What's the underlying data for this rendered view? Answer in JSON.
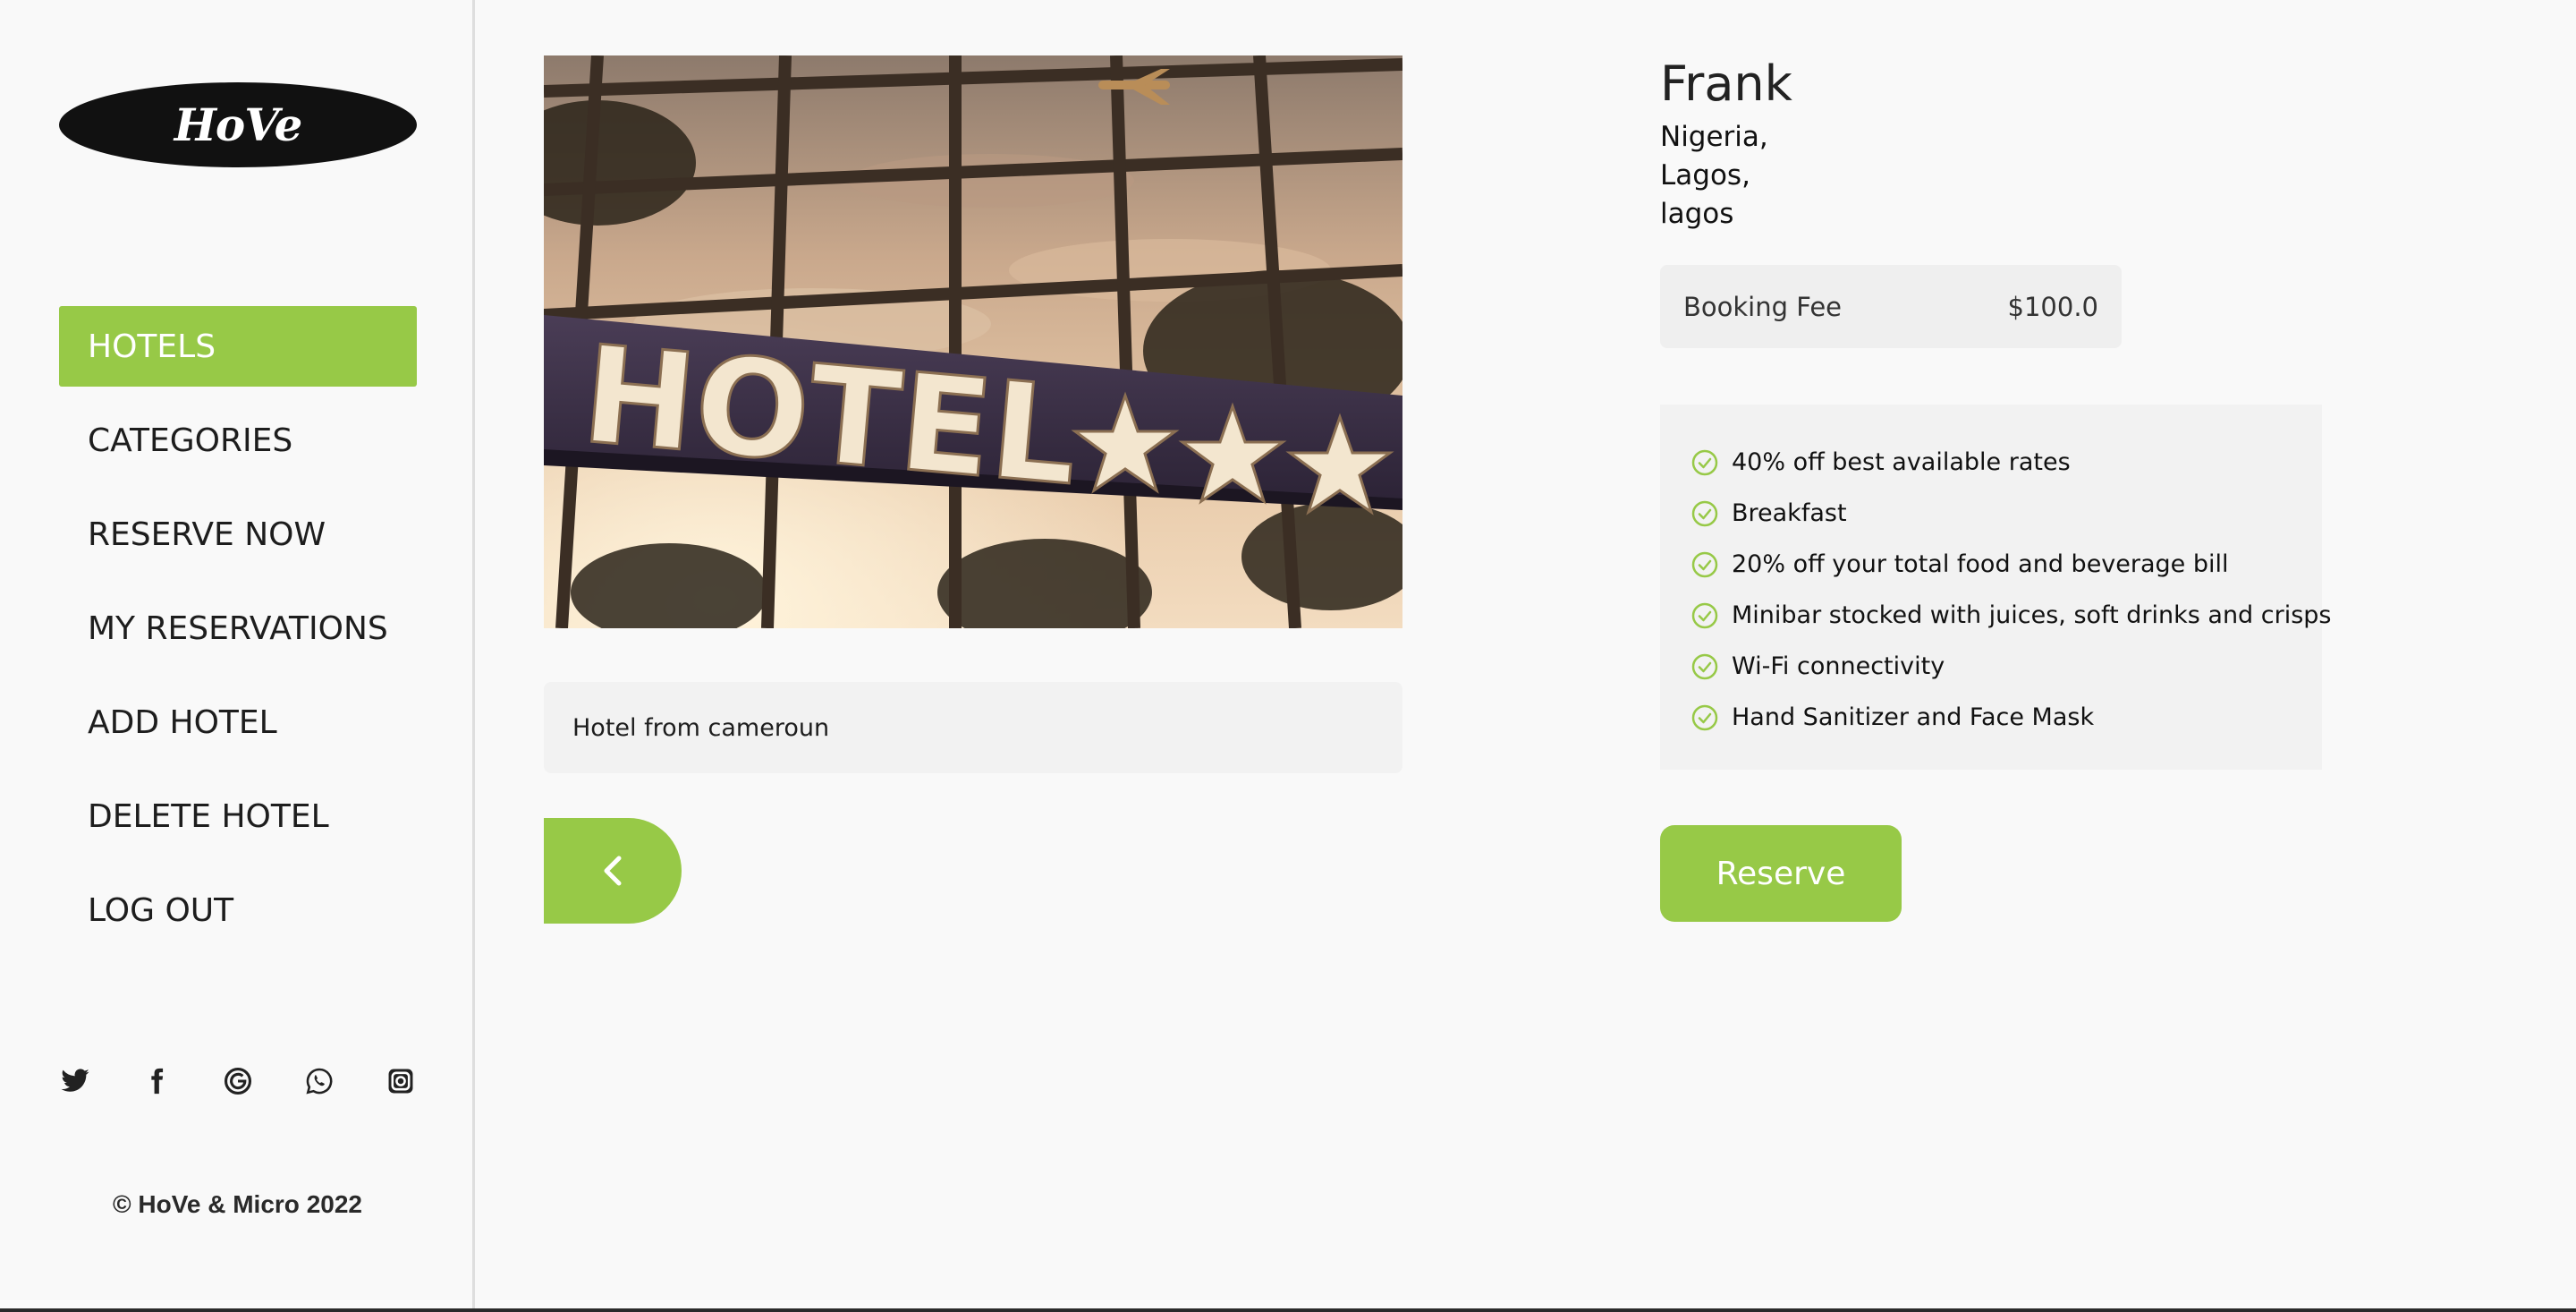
{
  "brand": {
    "logo_text": "HoVe",
    "accent_color": "#97c947"
  },
  "sidebar": {
    "nav": [
      {
        "label": "HOTELS",
        "active": true
      },
      {
        "label": "CATEGORIES",
        "active": false
      },
      {
        "label": "RESERVE NOW",
        "active": false
      },
      {
        "label": "MY RESERVATIONS",
        "active": false
      },
      {
        "label": "ADD HOTEL",
        "active": false
      },
      {
        "label": "DELETE HOTEL",
        "active": false
      },
      {
        "label": "LOG OUT",
        "active": false
      }
    ],
    "social_icons": [
      "twitter-icon",
      "facebook-icon",
      "google-icon",
      "whatsapp-icon",
      "instagram-icon"
    ],
    "copyright": "© HoVe & Micro 2022"
  },
  "hotel": {
    "image": {
      "sign_text": "HOTEL",
      "stars": 3
    },
    "description": "Hotel from cameroun",
    "name": "Frank",
    "location": [
      "Nigeria,",
      "Lagos,",
      "lagos"
    ],
    "booking_fee_label": "Booking Fee",
    "booking_fee_value": "$100.0",
    "perks": [
      "40% off best available rates",
      "Breakfast",
      "20% off your total food and beverage bill",
      "Minibar stocked with juices, soft drinks and crisps",
      "Wi-Fi connectivity",
      "Hand Sanitizer and Face Mask"
    ],
    "reserve_label": "Reserve",
    "back_icon": "chevron-left-icon"
  }
}
